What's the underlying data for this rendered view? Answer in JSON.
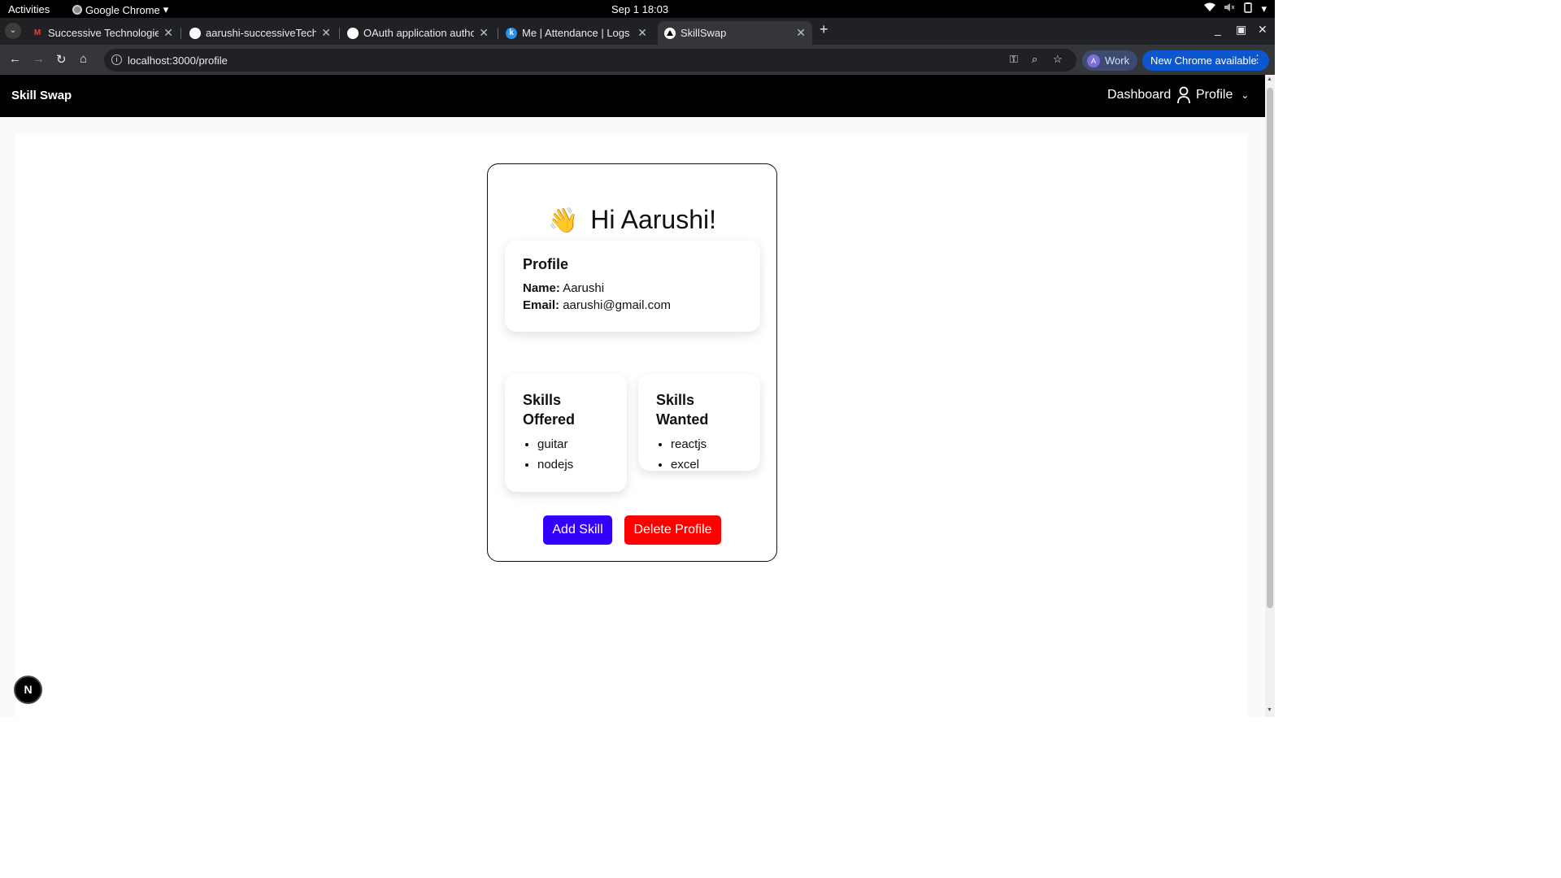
{
  "system_bar": {
    "activities": "Activities",
    "app_name": "Google Chrome",
    "clock": "Sep 1  18:03",
    "tray_icons": [
      "wifi-icon",
      "volume-muted-icon",
      "battery-icon",
      "power-menu-icon"
    ]
  },
  "tabs": [
    {
      "title": "Successive Technologies",
      "favicon": "gmail-icon",
      "active": false
    },
    {
      "title": "aarushi-successiveTech/s",
      "favicon": "github-icon",
      "active": false
    },
    {
      "title": "OAuth application autho",
      "favicon": "github-icon",
      "active": false
    },
    {
      "title": "Me | Attendance | Logs",
      "favicon": "keka-icon",
      "active": false
    },
    {
      "title": "SkillSwap",
      "favicon": "vercel-triangle-icon",
      "active": true
    }
  ],
  "toolbar": {
    "url": "localhost:3000/profile",
    "profile_chip": {
      "avatar": "A",
      "label": "Work"
    },
    "update_button": "New Chrome available"
  },
  "app_nav": {
    "brand": "Skill Swap",
    "dashboard_link": "Dashboard",
    "profile_link": "Profile"
  },
  "profile_card": {
    "greeting_emoji": "👋",
    "greeting": "Hi Aarushi!",
    "info": {
      "heading": "Profile",
      "name_label": "Name:",
      "name_value": "Aarushi",
      "email_label": "Email:",
      "email_value": "aarushi@gmail.com"
    },
    "skills_offered": {
      "heading": "Skills Offered",
      "items": [
        "guitar",
        "nodejs"
      ]
    },
    "skills_wanted": {
      "heading": "Skills Wanted",
      "items": [
        "reactjs",
        "excel"
      ]
    },
    "add_button": "Add Skill",
    "delete_button": "Delete Profile"
  },
  "dev_badge": "N",
  "colors": {
    "add_button": "#3300ff",
    "delete_button": "#ff0000",
    "app_nav_bg": "#000000",
    "update_chip": "#0b57d0"
  }
}
